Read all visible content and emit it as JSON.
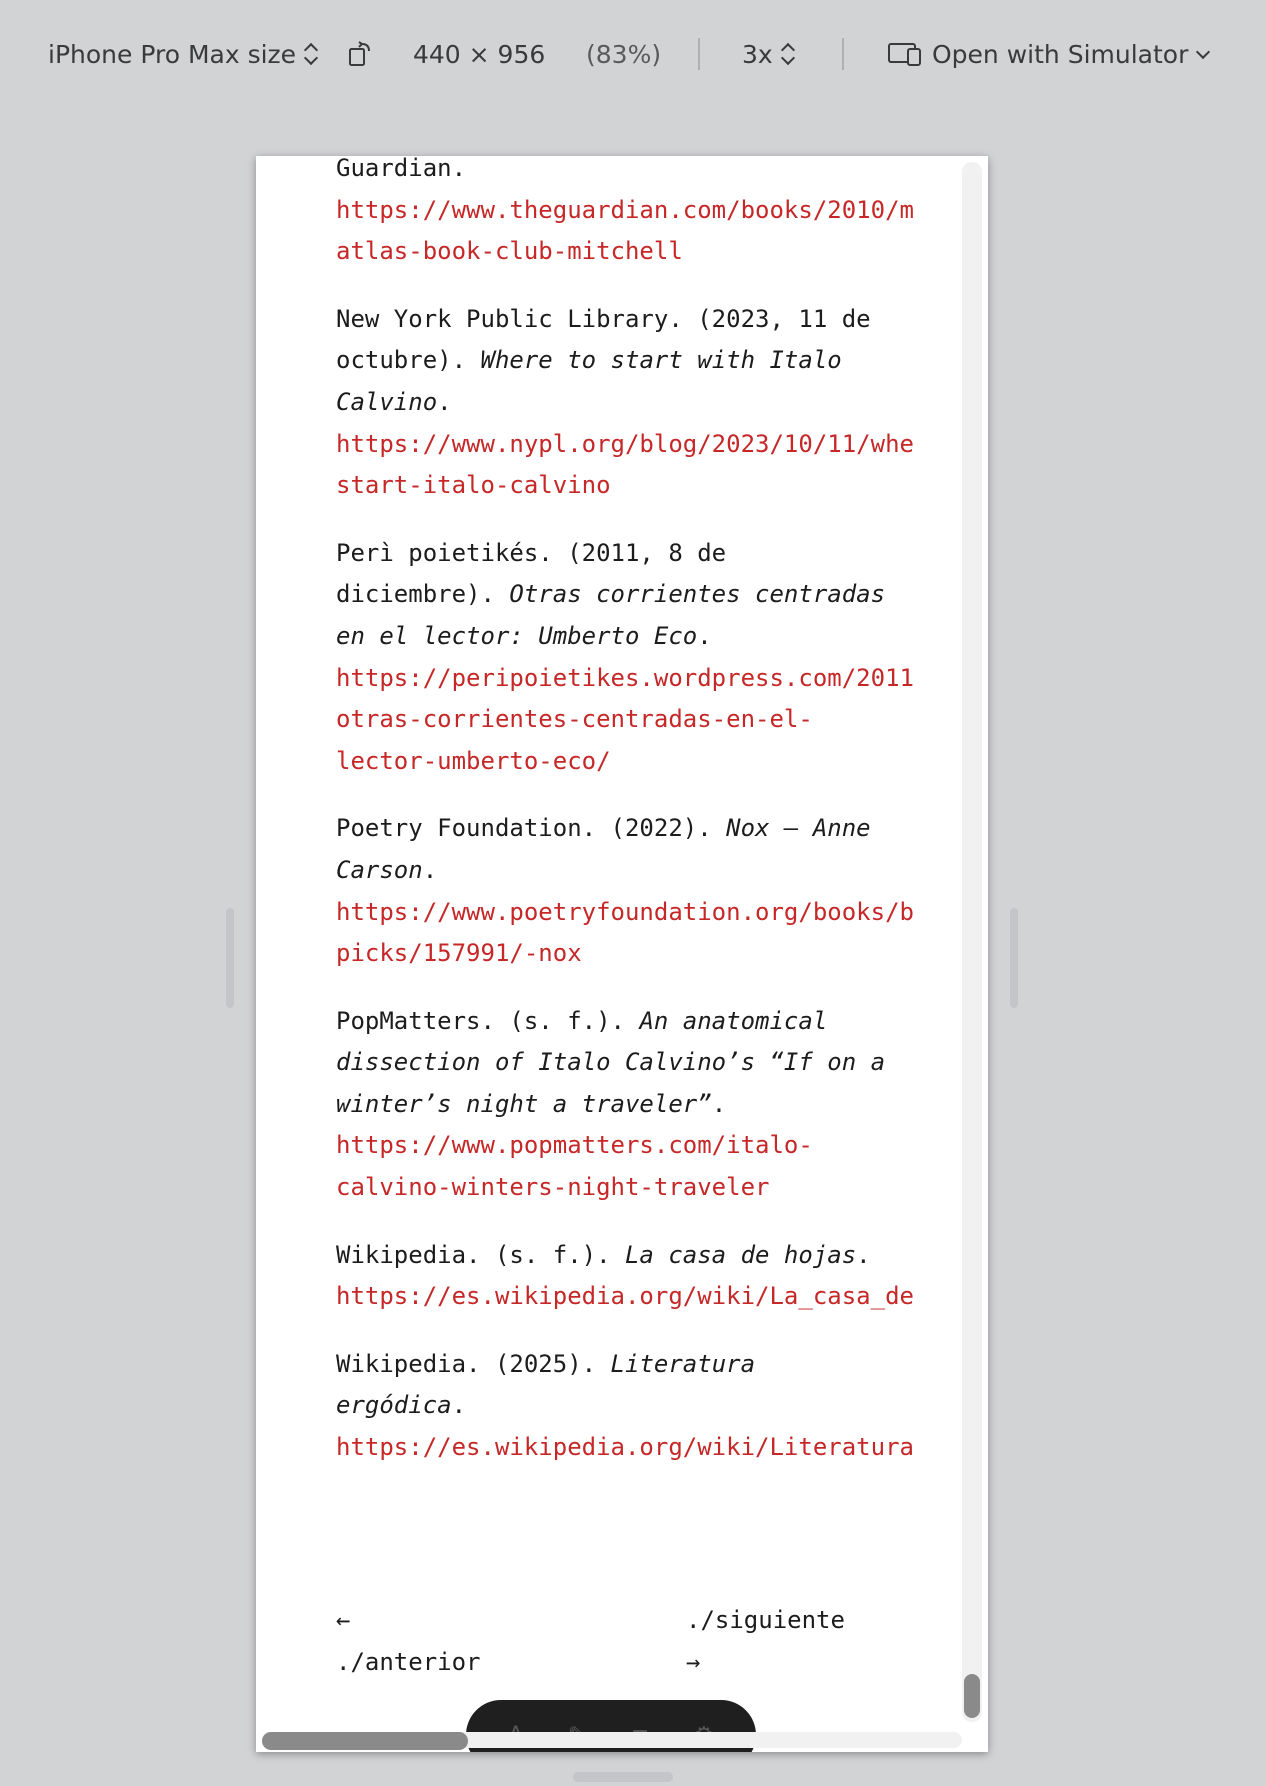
{
  "toolbar": {
    "device": "iPhone Pro Max size",
    "dimensions": "440 × 956",
    "zoom": "(83%)",
    "scale": "3x",
    "open_with": "Open with Simulator"
  },
  "references": [
    {
      "pre": "Guardian.",
      "title": "",
      "post": "",
      "link_lines": [
        "https://www.theguardian.com/books/2010/m",
        "atlas-book-club-mitchell"
      ]
    },
    {
      "pre": "New York Public Library. (2023, 11 de octubre). ",
      "title": "Where to start with Italo Calvino",
      "post": ".",
      "link_lines": [
        "https://www.nypl.org/blog/2023/10/11/whe",
        "start-italo-calvino"
      ]
    },
    {
      "pre": "Perì poietikés. (2011, 8 de diciembre). ",
      "title": "Otras corrientes centradas en el lector: Umberto Eco",
      "post": ".",
      "link_lines": [
        "https://peripoietikes.wordpress.com/2011",
        "otras-corrientes-centradas-en-el-",
        "lector-umberto-eco/"
      ]
    },
    {
      "pre": "Poetry Foundation. (2022). ",
      "title": "Nox – Anne Carson",
      "post": ".",
      "link_lines": [
        "https://www.poetryfoundation.org/books/b",
        "picks/157991/-nox"
      ]
    },
    {
      "pre": "PopMatters. (s. f.). ",
      "title": "An anatomical dissection of Italo Calvino’s “If on a winter’s night a traveler”",
      "post": ".",
      "link_lines": [
        "https://www.popmatters.com/italo-",
        "calvino-winters-night-traveler"
      ]
    },
    {
      "pre": "Wikipedia. (s. f.). ",
      "title": "La casa de hojas",
      "post": ".",
      "link_lines": [
        "https://es.wikipedia.org/wiki/La_casa_de"
      ]
    },
    {
      "pre": "Wikipedia. (2025). ",
      "title": "Literatura ergódica",
      "post": ".",
      "link_lines": [
        "https://es.wikipedia.org/wiki/Literatura"
      ]
    }
  ],
  "pager": {
    "prev_arrow": "←",
    "prev_label": "./anterior",
    "next_label": "./siguiente",
    "next_arrow": "→"
  }
}
